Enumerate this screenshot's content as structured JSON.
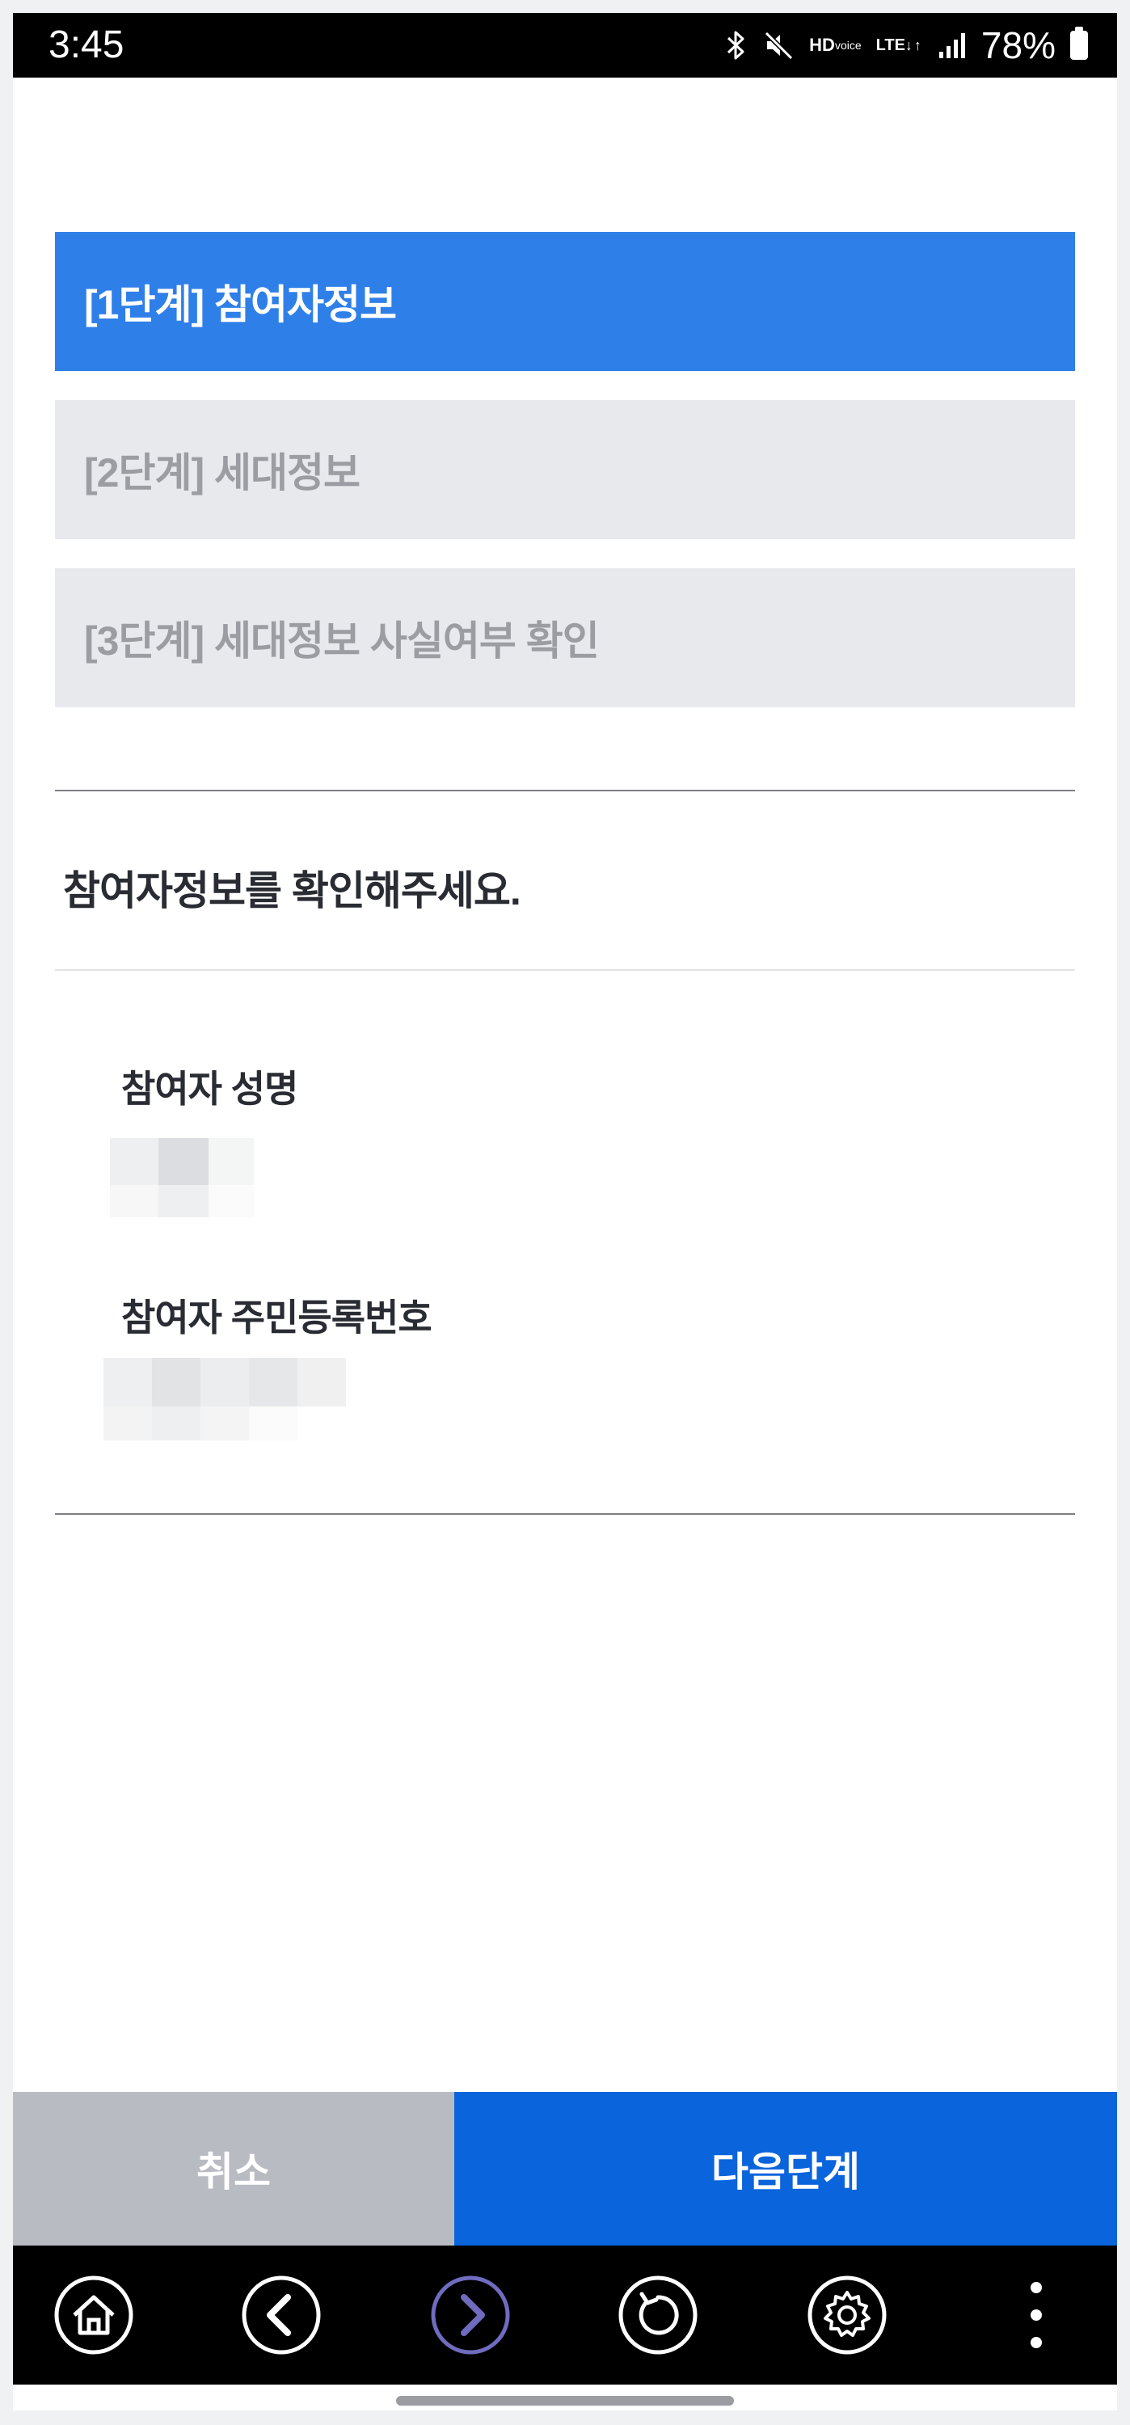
{
  "status_bar": {
    "time": "3:45",
    "battery": "78%",
    "hd_top": "HD",
    "hd_bottom": "voice",
    "lte_top": "LTE",
    "lte_bottom": "↓↑",
    "icons": [
      "bluetooth-icon",
      "mute-icon",
      "hd-voice-icon",
      "lte-icon",
      "signal-icon",
      "battery-icon"
    ]
  },
  "steps": [
    {
      "label": "[1단계] 참여자정보",
      "state": "active"
    },
    {
      "label": "[2단계] 세대정보",
      "state": "inactive"
    },
    {
      "label": "[3단계] 세대정보 사실여부 확인",
      "state": "inactive"
    }
  ],
  "section": {
    "title": "참여자정보를 확인해주세요."
  },
  "fields": {
    "name_label": "참여자 성명",
    "id_label": "참여자 주민등록번호"
  },
  "buttons": {
    "cancel": "취소",
    "next": "다음단계"
  },
  "nav": {
    "items": [
      "home-icon",
      "back-icon",
      "forward-icon",
      "refresh-icon",
      "settings-icon",
      "more-icon"
    ]
  },
  "colors": {
    "active_step": "#2f7fe8",
    "inactive_step": "#e8e9ec",
    "next_button": "#0a64dc",
    "cancel_button": "#b8bbc2",
    "forward_accent": "#6f6cc0"
  }
}
